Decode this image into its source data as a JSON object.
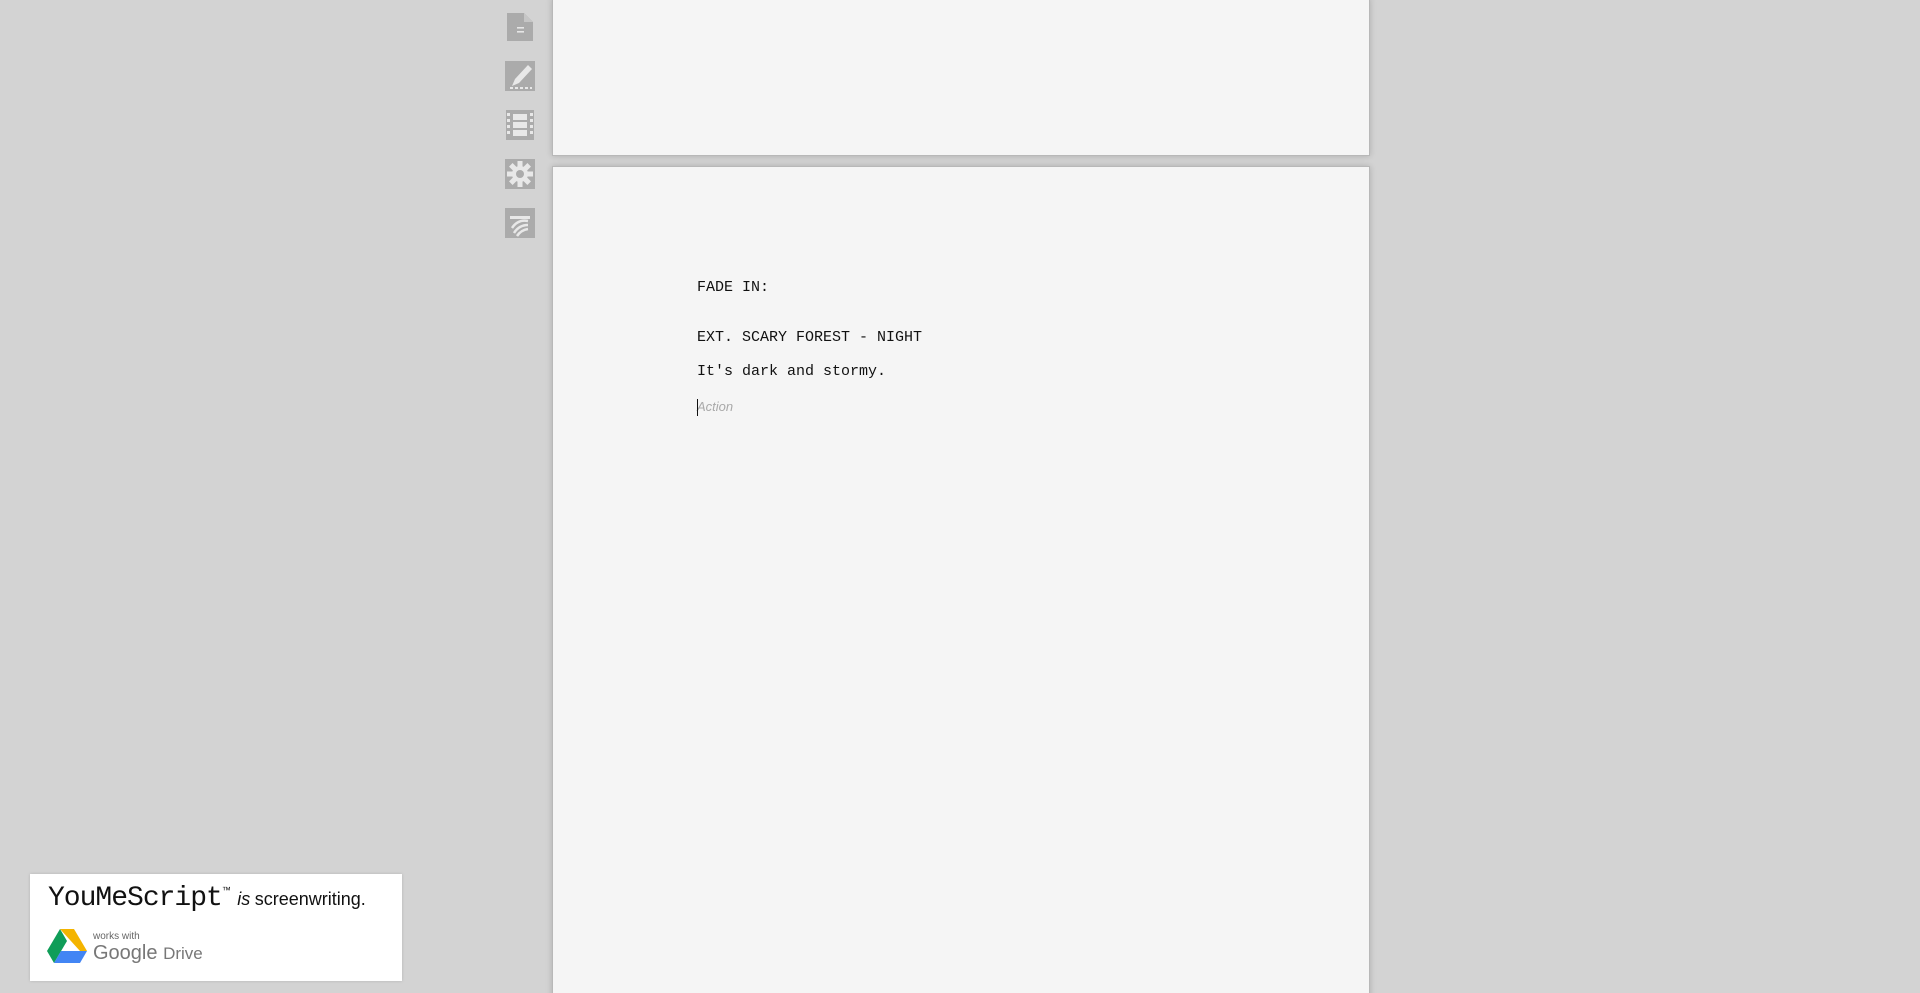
{
  "toolbar": {
    "items": [
      {
        "icon": "document-icon",
        "name": "document"
      },
      {
        "icon": "edit-icon",
        "name": "edit"
      },
      {
        "icon": "film-icon",
        "name": "scenes"
      },
      {
        "icon": "gear-icon",
        "name": "settings"
      },
      {
        "icon": "share-icon",
        "name": "share"
      }
    ]
  },
  "script": {
    "transition": "FADE IN:",
    "scene_heading": "EXT. SCARY FOREST - NIGHT",
    "action": "It's dark and stormy.",
    "active_element_placeholder": "Action"
  },
  "promo": {
    "brand": "YouMeScript",
    "trademark": "™",
    "is_word": "is",
    "tagline": "screenwriting.",
    "works_with": "works with",
    "google": "Google",
    "drive": "Drive"
  },
  "colors": {
    "background": "#d3d3d3",
    "page": "#f5f5f5",
    "icon": "#ababab",
    "placeholder": "#a9a9a9"
  }
}
